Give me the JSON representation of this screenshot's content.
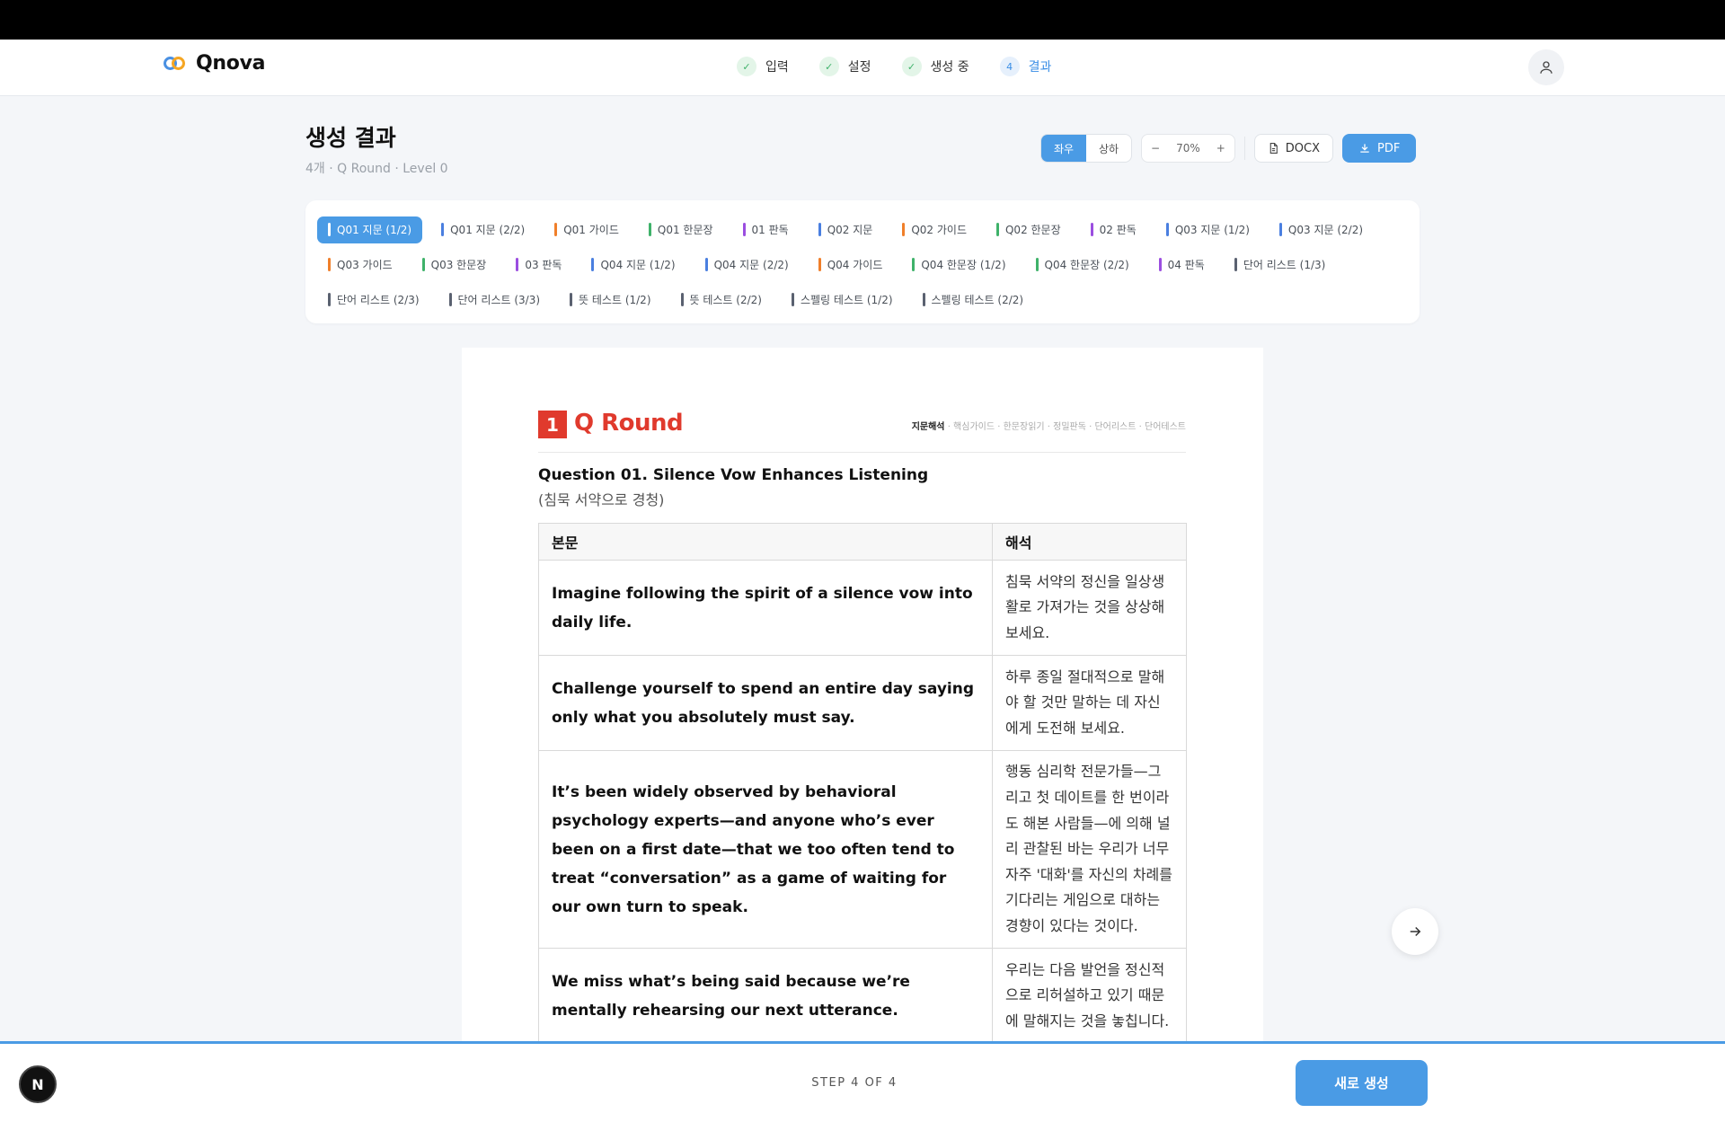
{
  "app": {
    "name": "Qnova"
  },
  "steps": [
    {
      "label": "입력",
      "marker": "✓",
      "state": "done"
    },
    {
      "label": "설정",
      "marker": "✓",
      "state": "done"
    },
    {
      "label": "생성 중",
      "marker": "✓",
      "state": "done"
    },
    {
      "label": "결과",
      "marker": "4",
      "state": "active"
    }
  ],
  "page": {
    "title": "생성 결과",
    "subtitle": "4개 · Q Round · Level 0"
  },
  "toolbar": {
    "layout_options": [
      "좌우",
      "상하"
    ],
    "layout_selected": "좌우",
    "zoom": "70%",
    "zoom_minus": "−",
    "zoom_plus": "+",
    "docx_label": "DOCX",
    "pdf_label": "PDF"
  },
  "chip_colors": {
    "blue": "#4a7fe0",
    "orange": "#f07f2a",
    "green": "#3fb26a",
    "purple": "#9b4ee0",
    "slate": "#5a6170"
  },
  "chips": [
    [
      {
        "label": "Q01 지문 (1/2)",
        "color": "blue",
        "selected": true
      },
      {
        "label": "Q01 지문 (2/2)",
        "color": "blue"
      },
      {
        "label": "Q01 가이드",
        "color": "orange"
      },
      {
        "label": "Q01 한문장",
        "color": "green"
      },
      {
        "label": "01 판독",
        "color": "purple"
      },
      {
        "label": "Q02 지문",
        "color": "blue"
      },
      {
        "label": "Q02 가이드",
        "color": "orange"
      },
      {
        "label": "Q02 한문장",
        "color": "green"
      },
      {
        "label": "02 판독",
        "color": "purple"
      },
      {
        "label": "Q03 지문 (1/2)",
        "color": "blue"
      },
      {
        "label": "Q03 지문 (2/2)",
        "color": "blue"
      }
    ],
    [
      {
        "label": "Q03 가이드",
        "color": "orange"
      },
      {
        "label": "Q03 한문장",
        "color": "green"
      },
      {
        "label": "03 판독",
        "color": "purple"
      },
      {
        "label": "Q04 지문 (1/2)",
        "color": "blue"
      },
      {
        "label": "Q04 지문 (2/2)",
        "color": "blue"
      },
      {
        "label": "Q04 가이드",
        "color": "orange"
      },
      {
        "label": "Q04 한문장 (1/2)",
        "color": "green"
      },
      {
        "label": "Q04 한문장 (2/2)",
        "color": "green"
      },
      {
        "label": "04 판독",
        "color": "purple"
      },
      {
        "label": "단어 리스트 (1/3)",
        "color": "slate"
      }
    ],
    [
      {
        "label": "단어 리스트 (2/3)",
        "color": "slate"
      },
      {
        "label": "단어 리스트 (3/3)",
        "color": "slate"
      },
      {
        "label": "뜻 테스트 (1/2)",
        "color": "slate"
      },
      {
        "label": "뜻 테스트 (2/2)",
        "color": "slate"
      },
      {
        "label": "스펠링 테스트 (1/2)",
        "color": "slate"
      },
      {
        "label": "스펠링 테스트 (2/2)",
        "color": "slate"
      }
    ]
  ],
  "doc": {
    "number": "1",
    "brand": "Q Round",
    "crumbs_current": "지문해석",
    "crumbs_rest": " · 핵심가이드 · 한문장읽기 · 정밀판독 · 단어리스트 · 단어테스트",
    "question_title": "Question 01. Silence Vow Enhances Listening",
    "question_sub": "(침묵 서약으로 경청)",
    "table_headers": [
      "본문",
      "해석"
    ],
    "rows": [
      {
        "en": "Imagine following the spirit of a silence vow into daily life.",
        "ko": "침묵 서약의 정신을 일상생활로 가져가는 것을 상상해 보세요."
      },
      {
        "en": "Challenge yourself to spend an entire day saying only what you absolutely must say.",
        "ko": "하루 종일 절대적으로 말해야 할 것만 말하는 데 자신에게 도전해 보세요."
      },
      {
        "en": "It’s been widely observed by behavioral psychology experts—and anyone who’s ever been on a first date—that we too often tend to treat “conversation” as a game of waiting for our own turn to speak.",
        "ko": "행동 심리학 전문가들—그리고 첫 데이트를 한 번이라도 해본 사람들—에 의해 널리 관찰된 바는 우리가 너무 자주 '대화'를 자신의 차례를 기다리는 게임으로 대하는 경향이 있다는 것이다."
      },
      {
        "en": "We miss what’s being said because we’re mentally rehearsing our next utterance.",
        "ko": "우리는 다음 발언을 정신적으로 리허설하고 있기 때문에 말해지는 것을 놓칩니다."
      }
    ]
  },
  "footer": {
    "step_label": "STEP 4 OF 4",
    "new_button": "새로 생성",
    "badge": "N"
  }
}
